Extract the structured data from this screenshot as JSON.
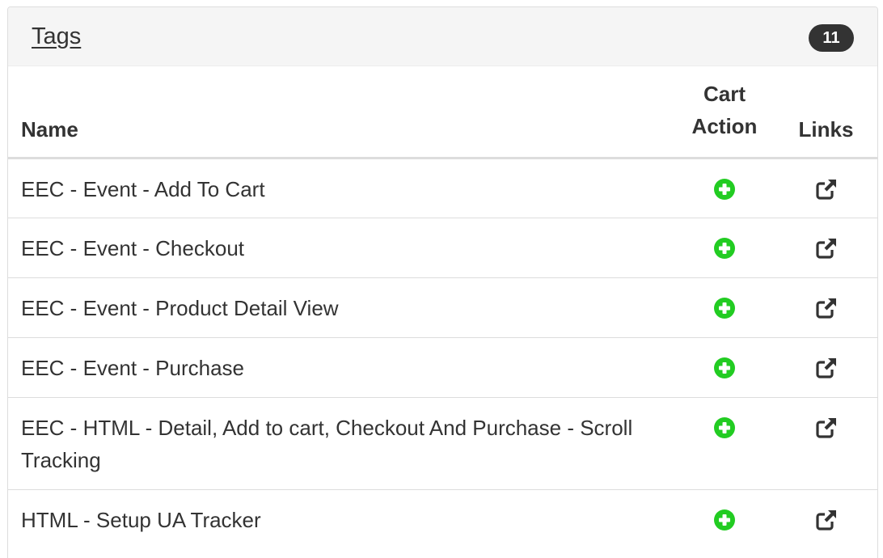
{
  "panel": {
    "title": "Tags",
    "count": "11"
  },
  "table": {
    "headers": {
      "name": "Name",
      "cart_action": "Cart\nAction",
      "links": "Links"
    },
    "rows": [
      {
        "name": "EEC - Event - Add To Cart",
        "cart_icon": "plus-circle-icon",
        "link_icon": "external-link-icon"
      },
      {
        "name": "EEC - Event - Checkout",
        "cart_icon": "plus-circle-icon",
        "link_icon": "external-link-icon"
      },
      {
        "name": "EEC - Event - Product Detail View",
        "cart_icon": "plus-circle-icon",
        "link_icon": "external-link-icon"
      },
      {
        "name": "EEC - Event - Purchase",
        "cart_icon": "plus-circle-icon",
        "link_icon": "external-link-icon"
      },
      {
        "name": "EEC - HTML - Detail, Add to cart, Checkout And Purchase - Scroll Tracking",
        "cart_icon": "plus-circle-icon",
        "link_icon": "external-link-icon"
      },
      {
        "name": "HTML - Setup UA Tracker",
        "cart_icon": "plus-circle-icon",
        "link_icon": "external-link-icon"
      }
    ]
  },
  "colors": {
    "cart_action_green": "#22cc22",
    "badge_bg": "#333333",
    "heading_bg": "#f5f5f5"
  }
}
